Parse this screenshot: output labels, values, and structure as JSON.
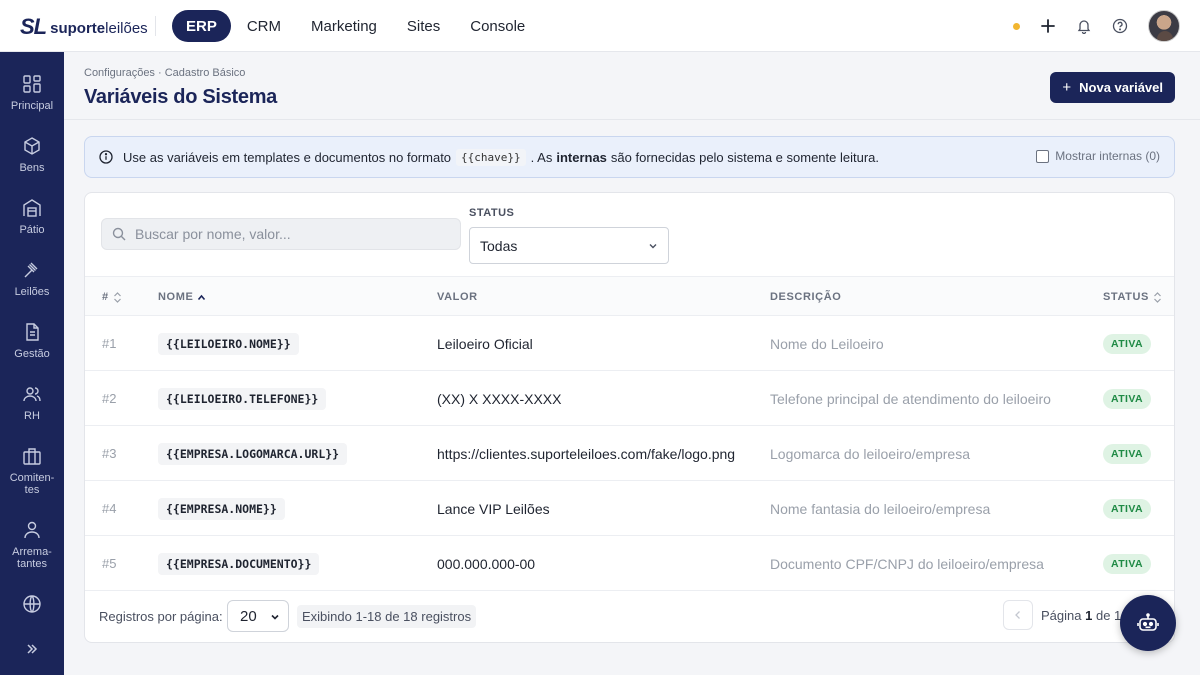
{
  "brand": {
    "mark": "SL",
    "name_bold": "suporte",
    "name_light": "leilões"
  },
  "topnav": [
    {
      "label": "ERP",
      "active": true
    },
    {
      "label": "CRM",
      "active": false
    },
    {
      "label": "Marketing",
      "active": false
    },
    {
      "label": "Sites",
      "active": false
    },
    {
      "label": "Console",
      "active": false
    }
  ],
  "sidebar": [
    {
      "label": "Principal",
      "icon": "dashboard-icon"
    },
    {
      "label": "Bens",
      "icon": "box-icon"
    },
    {
      "label": "Pátio",
      "icon": "warehouse-icon"
    },
    {
      "label": "Leilões",
      "icon": "gavel-icon"
    },
    {
      "label": "Gestão",
      "icon": "document-icon"
    },
    {
      "label": "RH",
      "icon": "users-icon"
    },
    {
      "label": "Comiten-",
      "label2": "tes",
      "icon": "briefcase-icon"
    },
    {
      "label": "Arrema-",
      "label2": "tantes",
      "icon": "user-icon"
    },
    {
      "label": "",
      "icon": "globe-icon"
    }
  ],
  "page": {
    "breadcrumb": "Configurações · Cadastro Básico",
    "title": "Variáveis do Sistema",
    "new_button": "Nova variável"
  },
  "info": {
    "text_before": "Use as variáveis em templates e documentos no formato",
    "code": "{{chave}}",
    "text_mid": ". As",
    "bold": "internas",
    "text_after": "são fornecidas pelo sistema e somente leitura.",
    "toggle_label": "Mostrar internas (0)"
  },
  "filters": {
    "search_placeholder": "Buscar por nome, valor...",
    "status_label": "STATUS",
    "status_value": "Todas"
  },
  "table": {
    "headers": {
      "id": "#",
      "name": "NOME",
      "value": "VALOR",
      "description": "DESCRIÇÃO",
      "status": "STATUS"
    },
    "rows": [
      {
        "id": "#1",
        "name": "{{LEILOEIRO.NOME}}",
        "value": "Leiloeiro Oficial",
        "description": "Nome do Leiloeiro",
        "status": "ATIVA"
      },
      {
        "id": "#2",
        "name": "{{LEILOEIRO.TELEFONE}}",
        "value": "(XX) X XXXX-XXXX",
        "description": "Telefone principal de atendimento do leiloeiro",
        "status": "ATIVA"
      },
      {
        "id": "#3",
        "name": "{{EMPRESA.LOGOMARCA.URL}}",
        "value": "https://clientes.suporteleiloes.com/fake/logo.png",
        "description": "Logomarca do leiloeiro/empresa",
        "status": "ATIVA"
      },
      {
        "id": "#4",
        "name": "{{EMPRESA.NOME}}",
        "value": "Lance VIP Leilões",
        "description": "Nome fantasia do leiloeiro/empresa",
        "status": "ATIVA"
      },
      {
        "id": "#5",
        "name": "{{EMPRESA.DOCUMENTO}}",
        "value": "000.000.000-00",
        "description": "Documento CPF/CNPJ do leiloeiro/empresa",
        "status": "ATIVA"
      }
    ]
  },
  "pagination": {
    "per_page_label": "Registros por página:",
    "per_page_value": "20",
    "showing": "Exibindo 1-18 de 18 registros",
    "page_prefix": "Página",
    "current_page": "1",
    "page_of": "de 1"
  },
  "colors": {
    "primary": "#1b2559",
    "active_badge_bg": "#dff3e4",
    "active_badge_text": "#1f8a45",
    "notification_dot": "#f2b630"
  }
}
